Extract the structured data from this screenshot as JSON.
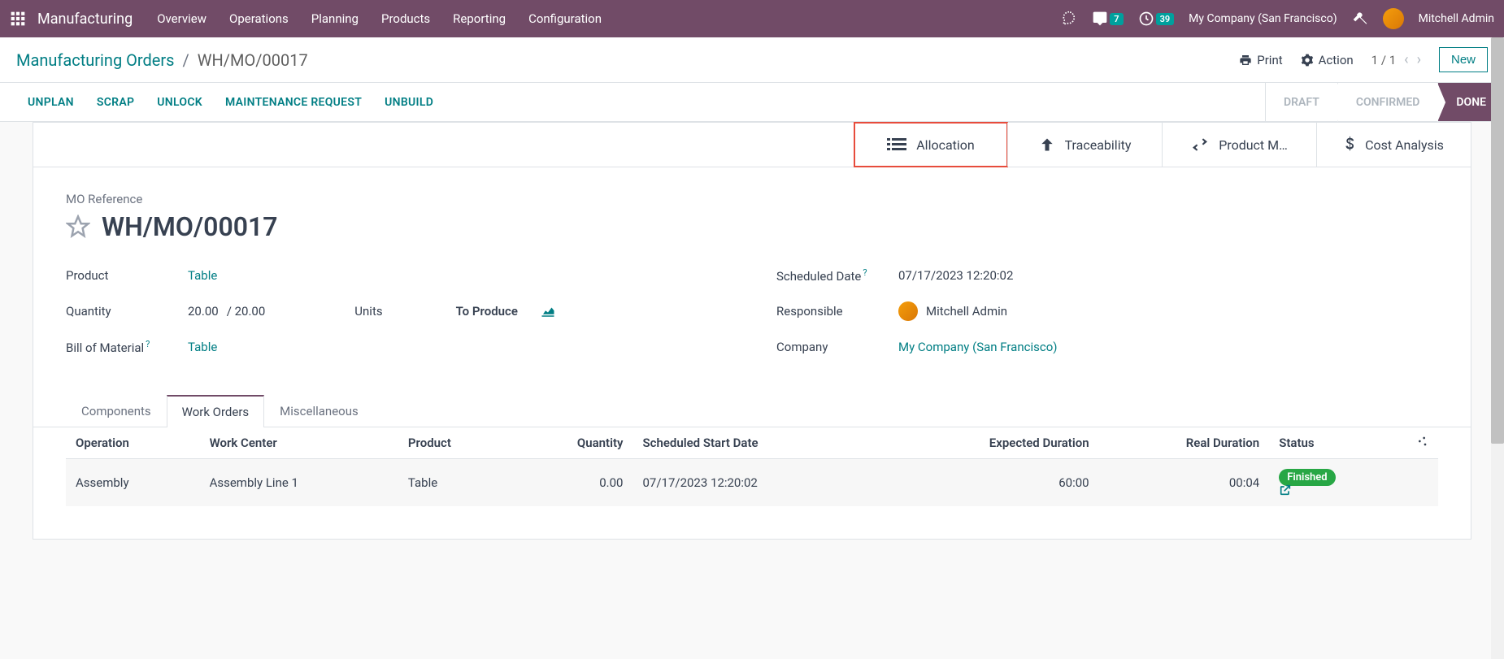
{
  "topbar": {
    "app_name": "Manufacturing",
    "menu": [
      "Overview",
      "Operations",
      "Planning",
      "Products",
      "Reporting",
      "Configuration"
    ],
    "messages_badge": "7",
    "activities_badge": "39",
    "company": "My Company (San Francisco)",
    "user": "Mitchell Admin"
  },
  "breadcrumb": {
    "parent": "Manufacturing Orders",
    "current": "WH/MO/00017"
  },
  "header_actions": {
    "print": "Print",
    "action": "Action",
    "pager": "1 / 1",
    "new": "New"
  },
  "action_buttons": [
    "UNPLAN",
    "SCRAP",
    "UNLOCK",
    "MAINTENANCE REQUEST",
    "UNBUILD"
  ],
  "status_steps": [
    "DRAFT",
    "CONFIRMED",
    "DONE"
  ],
  "smart_buttons": {
    "allocation": "Allocation",
    "traceability": "Traceability",
    "product_moves": "Product M…",
    "cost_analysis": "Cost Analysis"
  },
  "mo": {
    "ref_label": "MO Reference",
    "ref": "WH/MO/00017",
    "product_label": "Product",
    "product": "Table",
    "quantity_label": "Quantity",
    "quantity": "20.00",
    "quantity_total": "/ 20.00",
    "units": "Units",
    "to_produce": "To Produce",
    "bom_label": "Bill of Material",
    "bom": "Table",
    "scheduled_label": "Scheduled Date",
    "scheduled": "07/17/2023 12:20:02",
    "responsible_label": "Responsible",
    "responsible": "Mitchell Admin",
    "company_label": "Company",
    "company": "My Company (San Francisco)"
  },
  "detail_tabs": [
    "Components",
    "Work Orders",
    "Miscellaneous"
  ],
  "table": {
    "headers": {
      "operation": "Operation",
      "work_center": "Work Center",
      "product": "Product",
      "quantity": "Quantity",
      "scheduled": "Scheduled Start Date",
      "expected": "Expected Duration",
      "real": "Real Duration",
      "status": "Status"
    },
    "rows": [
      {
        "operation": "Assembly",
        "work_center": "Assembly Line 1",
        "product": "Table",
        "quantity": "0.00",
        "scheduled": "07/17/2023 12:20:02",
        "expected": "60:00",
        "real": "00:04",
        "status": "Finished"
      }
    ]
  }
}
